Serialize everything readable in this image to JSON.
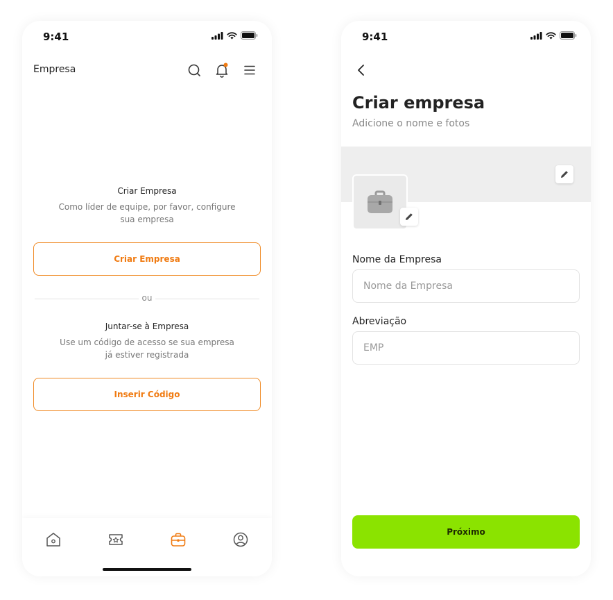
{
  "status_bar": {
    "time": "9:41"
  },
  "company_screen": {
    "title": "Empresa",
    "create": {
      "title": "Criar Empresa",
      "description": "Como líder de equipe, por favor, configure sua empresa",
      "button_label": "Criar Empresa"
    },
    "divider_label": "ou",
    "join": {
      "title": "Juntar-se à Empresa",
      "description": "Use um código de acesso se sua empresa já estiver registrada",
      "button_label": "Inserir Código"
    },
    "tabs": [
      {
        "icon": "home-icon",
        "active": false
      },
      {
        "icon": "ticket-icon",
        "active": false
      },
      {
        "icon": "briefcase-icon",
        "active": true
      },
      {
        "icon": "user-icon",
        "active": false
      }
    ]
  },
  "create_company_screen": {
    "title": "Criar empresa",
    "subtitle": "Adicione o nome e fotos",
    "fields": {
      "name": {
        "label": "Nome da Empresa",
        "value": "",
        "placeholder": "Nome da Empresa"
      },
      "abbreviation": {
        "label": "Abreviação",
        "value": "",
        "placeholder": "EMP"
      }
    },
    "next_button_label": "Próximo"
  },
  "colors": {
    "accent_orange": "#f07b12",
    "primary_green": "#8be300",
    "notification_dot": "#f07b12"
  }
}
